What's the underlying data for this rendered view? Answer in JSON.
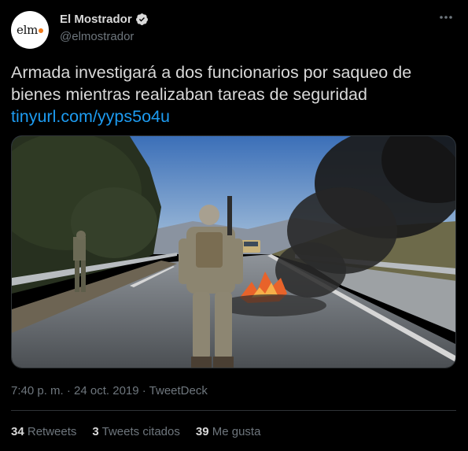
{
  "account": {
    "avatar_text": "elm",
    "display_name": "El Mostrador",
    "handle": "@elmostrador"
  },
  "tweet": {
    "text": "Armada investigará a dos funcionarios por saqueo de bienes mientras realizaban tareas de seguridad",
    "link": "tinyurl.com/yyps5o4u",
    "timestamp": "7:40 p. m. · 24 oct. 2019 · TweetDeck"
  },
  "stats": {
    "retweets_count": "34",
    "retweets_label": "Retweets",
    "quotes_count": "3",
    "quotes_label": "Tweets citados",
    "likes_count": "39",
    "likes_label": "Me gusta"
  },
  "icons": {
    "verified": "verified-badge-icon",
    "more": "more-options-icon"
  },
  "colors": {
    "background": "#000000",
    "text": "#d9d9d9",
    "muted": "#6e767d",
    "link": "#1d9bf0",
    "avatar_dot": "#f07a1b"
  }
}
